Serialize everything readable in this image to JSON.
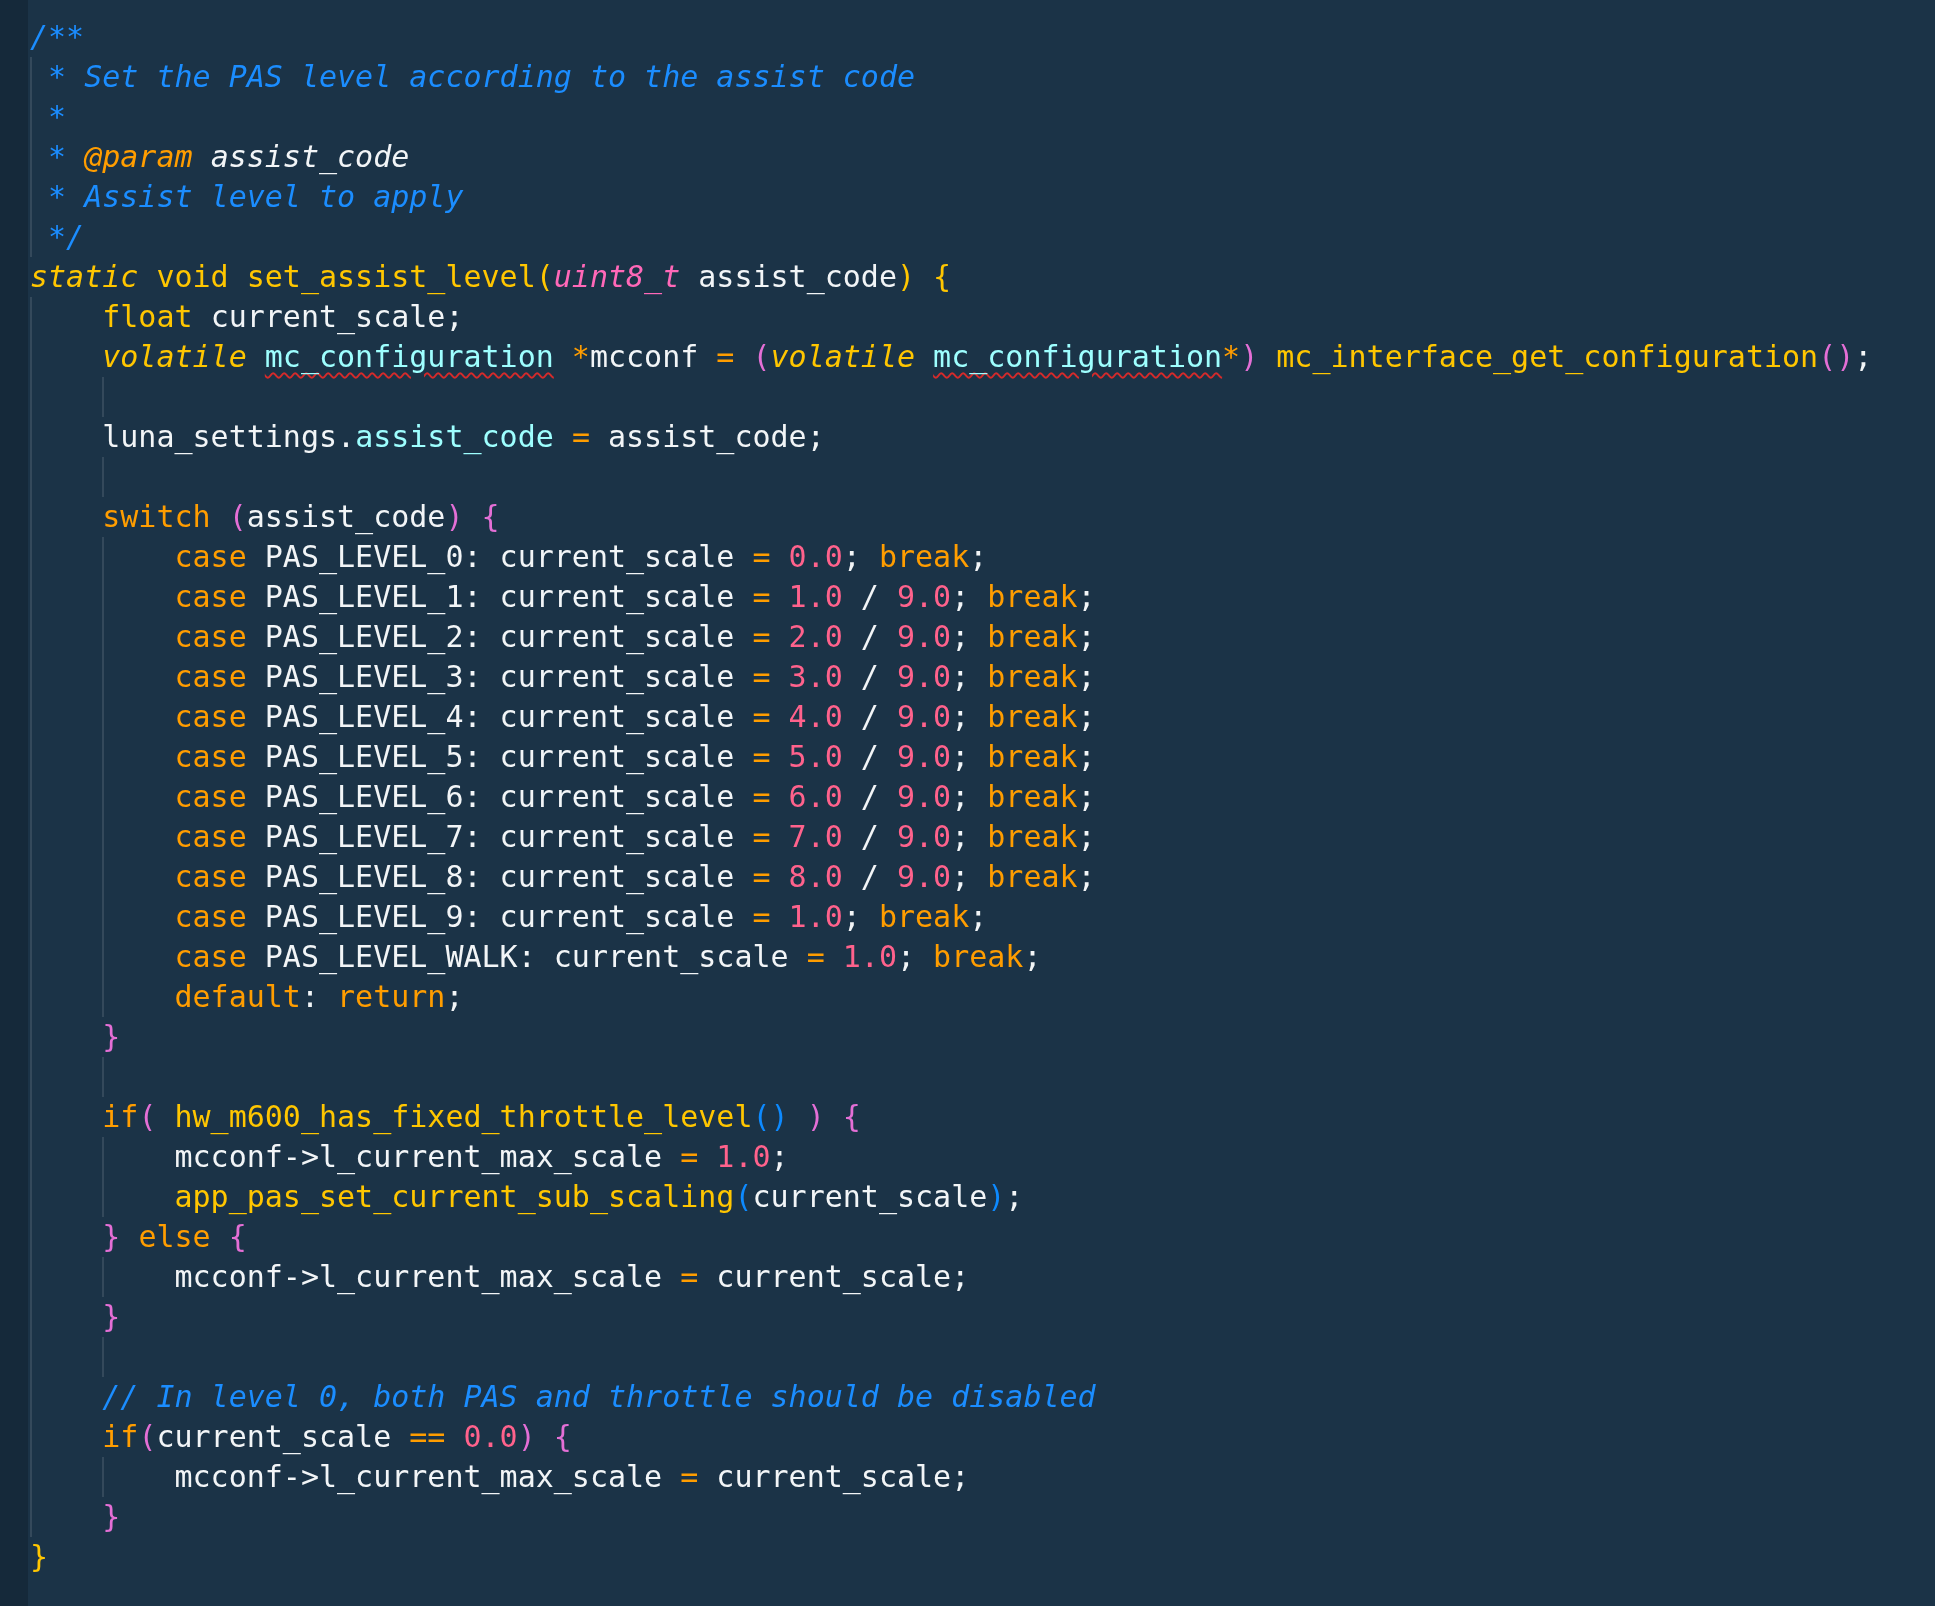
{
  "editor": {
    "lines": [
      {
        "kind": "code",
        "tokens": [
          {
            "text": "/**",
            "kind": "comment"
          }
        ]
      },
      {
        "kind": "code",
        "tokens": [
          {
            "text": " * Set the PAS level according to the assist code",
            "kind": "comment"
          }
        ]
      },
      {
        "kind": "code",
        "tokens": [
          {
            "text": " *",
            "kind": "comment"
          }
        ]
      },
      {
        "kind": "code",
        "tokens": [
          {
            "text": " *",
            "kind": "comment"
          },
          {
            "text": " @param",
            "kind": "doctag"
          },
          {
            "text": " assist_code",
            "kind": "docparam"
          }
        ]
      },
      {
        "kind": "code",
        "tokens": [
          {
            "text": " * Assist level to apply",
            "kind": "comment"
          }
        ]
      },
      {
        "kind": "code",
        "tokens": [
          {
            "text": " */",
            "kind": "comment"
          }
        ]
      },
      {
        "kind": "code",
        "tokens": [
          {
            "text": "static",
            "kind": "storage"
          },
          {
            "text": " void",
            "kind": "keyword"
          },
          {
            "text": " set_assist_level",
            "kind": "function"
          },
          {
            "text": "(",
            "kind": "fnbrace"
          },
          {
            "text": "uint8_t",
            "kind": "type"
          },
          {
            "text": " assist_code",
            "kind": "identifier"
          },
          {
            "text": ")",
            "kind": "fnbrace"
          },
          {
            "text": " {",
            "kind": "fnbrace"
          }
        ]
      },
      {
        "kind": "code",
        "tokens": [
          {
            "text": "    float",
            "kind": "keyword"
          },
          {
            "text": " current_scale;",
            "kind": "identifier"
          }
        ]
      },
      {
        "kind": "code",
        "tokens": [
          {
            "text": "    volatile",
            "kind": "storage"
          },
          {
            "text": " mc_configuration",
            "kind": "typeref",
            "error": true
          },
          {
            "text": " *",
            "kind": "operator"
          },
          {
            "text": "mcconf",
            "kind": "identifier"
          },
          {
            "text": " =",
            "kind": "operator"
          },
          {
            "text": " (",
            "kind": "bracket"
          },
          {
            "text": "volatile",
            "kind": "storage"
          },
          {
            "text": " mc_configuration",
            "kind": "typeref",
            "error": true
          },
          {
            "text": "*",
            "kind": "operator"
          },
          {
            "text": ")",
            "kind": "bracket"
          },
          {
            "text": " mc_interface_get_configuration",
            "kind": "function"
          },
          {
            "text": "()",
            "kind": "bracket"
          },
          {
            "text": ";",
            "kind": "identifier"
          }
        ]
      },
      {
        "kind": "blank"
      },
      {
        "kind": "code",
        "tokens": [
          {
            "text": "    luna_settings.",
            "kind": "identifier"
          },
          {
            "text": "assist_code",
            "kind": "member"
          },
          {
            "text": " =",
            "kind": "operator"
          },
          {
            "text": " assist_code;",
            "kind": "identifier"
          }
        ]
      },
      {
        "kind": "blank"
      },
      {
        "kind": "code",
        "tokens": [
          {
            "text": "    switch",
            "kind": "control"
          },
          {
            "text": " (",
            "kind": "bracket"
          },
          {
            "text": "assist_code",
            "kind": "identifier"
          },
          {
            "text": ")",
            "kind": "bracket"
          },
          {
            "text": " {",
            "kind": "bracket"
          }
        ]
      },
      {
        "kind": "code",
        "tokens": [
          {
            "text": "        case",
            "kind": "control"
          },
          {
            "text": " PAS_LEVEL_0: current_scale",
            "kind": "identifier"
          },
          {
            "text": " =",
            "kind": "operator"
          },
          {
            "text": " 0.0",
            "kind": "number"
          },
          {
            "text": ";",
            "kind": "identifier"
          },
          {
            "text": " break",
            "kind": "control"
          },
          {
            "text": ";",
            "kind": "identifier"
          }
        ]
      },
      {
        "kind": "code",
        "tokens": [
          {
            "text": "        case",
            "kind": "control"
          },
          {
            "text": " PAS_LEVEL_1: current_scale",
            "kind": "identifier"
          },
          {
            "text": " =",
            "kind": "operator"
          },
          {
            "text": " 1.0",
            "kind": "number"
          },
          {
            "text": " /",
            "kind": "identifier"
          },
          {
            "text": " 9.0",
            "kind": "number"
          },
          {
            "text": ";",
            "kind": "identifier"
          },
          {
            "text": " break",
            "kind": "control"
          },
          {
            "text": ";",
            "kind": "identifier"
          }
        ]
      },
      {
        "kind": "code",
        "tokens": [
          {
            "text": "        case",
            "kind": "control"
          },
          {
            "text": " PAS_LEVEL_2: current_scale",
            "kind": "identifier"
          },
          {
            "text": " =",
            "kind": "operator"
          },
          {
            "text": " 2.0",
            "kind": "number"
          },
          {
            "text": " /",
            "kind": "identifier"
          },
          {
            "text": " 9.0",
            "kind": "number"
          },
          {
            "text": ";",
            "kind": "identifier"
          },
          {
            "text": " break",
            "kind": "control"
          },
          {
            "text": ";",
            "kind": "identifier"
          }
        ]
      },
      {
        "kind": "code",
        "tokens": [
          {
            "text": "        case",
            "kind": "control"
          },
          {
            "text": " PAS_LEVEL_3: current_scale",
            "kind": "identifier"
          },
          {
            "text": " =",
            "kind": "operator"
          },
          {
            "text": " 3.0",
            "kind": "number"
          },
          {
            "text": " /",
            "kind": "identifier"
          },
          {
            "text": " 9.0",
            "kind": "number"
          },
          {
            "text": ";",
            "kind": "identifier"
          },
          {
            "text": " break",
            "kind": "control"
          },
          {
            "text": ";",
            "kind": "identifier"
          }
        ]
      },
      {
        "kind": "code",
        "tokens": [
          {
            "text": "        case",
            "kind": "control"
          },
          {
            "text": " PAS_LEVEL_4: current_scale",
            "kind": "identifier"
          },
          {
            "text": " =",
            "kind": "operator"
          },
          {
            "text": " 4.0",
            "kind": "number"
          },
          {
            "text": " /",
            "kind": "identifier"
          },
          {
            "text": " 9.0",
            "kind": "number"
          },
          {
            "text": ";",
            "kind": "identifier"
          },
          {
            "text": " break",
            "kind": "control"
          },
          {
            "text": ";",
            "kind": "identifier"
          }
        ]
      },
      {
        "kind": "code",
        "tokens": [
          {
            "text": "        case",
            "kind": "control"
          },
          {
            "text": " PAS_LEVEL_5: current_scale",
            "kind": "identifier"
          },
          {
            "text": " =",
            "kind": "operator"
          },
          {
            "text": " 5.0",
            "kind": "number"
          },
          {
            "text": " /",
            "kind": "identifier"
          },
          {
            "text": " 9.0",
            "kind": "number"
          },
          {
            "text": ";",
            "kind": "identifier"
          },
          {
            "text": " break",
            "kind": "control"
          },
          {
            "text": ";",
            "kind": "identifier"
          }
        ]
      },
      {
        "kind": "code",
        "tokens": [
          {
            "text": "        case",
            "kind": "control"
          },
          {
            "text": " PAS_LEVEL_6: current_scale",
            "kind": "identifier"
          },
          {
            "text": " =",
            "kind": "operator"
          },
          {
            "text": " 6.0",
            "kind": "number"
          },
          {
            "text": " /",
            "kind": "identifier"
          },
          {
            "text": " 9.0",
            "kind": "number"
          },
          {
            "text": ";",
            "kind": "identifier"
          },
          {
            "text": " break",
            "kind": "control"
          },
          {
            "text": ";",
            "kind": "identifier"
          }
        ]
      },
      {
        "kind": "code",
        "tokens": [
          {
            "text": "        case",
            "kind": "control"
          },
          {
            "text": " PAS_LEVEL_7: current_scale",
            "kind": "identifier"
          },
          {
            "text": " =",
            "kind": "operator"
          },
          {
            "text": " 7.0",
            "kind": "number"
          },
          {
            "text": " /",
            "kind": "identifier"
          },
          {
            "text": " 9.0",
            "kind": "number"
          },
          {
            "text": ";",
            "kind": "identifier"
          },
          {
            "text": " break",
            "kind": "control"
          },
          {
            "text": ";",
            "kind": "identifier"
          }
        ]
      },
      {
        "kind": "code",
        "tokens": [
          {
            "text": "        case",
            "kind": "control"
          },
          {
            "text": " PAS_LEVEL_8: current_scale",
            "kind": "identifier"
          },
          {
            "text": " =",
            "kind": "operator"
          },
          {
            "text": " 8.0",
            "kind": "number"
          },
          {
            "text": " /",
            "kind": "identifier"
          },
          {
            "text": " 9.0",
            "kind": "number"
          },
          {
            "text": ";",
            "kind": "identifier"
          },
          {
            "text": " break",
            "kind": "control"
          },
          {
            "text": ";",
            "kind": "identifier"
          }
        ]
      },
      {
        "kind": "code",
        "tokens": [
          {
            "text": "        case",
            "kind": "control"
          },
          {
            "text": " PAS_LEVEL_9: current_scale",
            "kind": "identifier"
          },
          {
            "text": " =",
            "kind": "operator"
          },
          {
            "text": " 1.0",
            "kind": "number"
          },
          {
            "text": ";",
            "kind": "identifier"
          },
          {
            "text": " break",
            "kind": "control"
          },
          {
            "text": ";",
            "kind": "identifier"
          }
        ]
      },
      {
        "kind": "code",
        "tokens": [
          {
            "text": "        case",
            "kind": "control"
          },
          {
            "text": " PAS_LEVEL_WALK: current_scale",
            "kind": "identifier"
          },
          {
            "text": " =",
            "kind": "operator"
          },
          {
            "text": " 1.0",
            "kind": "number"
          },
          {
            "text": ";",
            "kind": "identifier"
          },
          {
            "text": " break",
            "kind": "control"
          },
          {
            "text": ";",
            "kind": "identifier"
          }
        ]
      },
      {
        "kind": "code",
        "tokens": [
          {
            "text": "        default",
            "kind": "control"
          },
          {
            "text": ":",
            "kind": "identifier"
          },
          {
            "text": " return",
            "kind": "control"
          },
          {
            "text": ";",
            "kind": "identifier"
          }
        ]
      },
      {
        "kind": "code",
        "tokens": [
          {
            "text": "    }",
            "kind": "bracket"
          }
        ]
      },
      {
        "kind": "blank"
      },
      {
        "kind": "code",
        "tokens": [
          {
            "text": "    if",
            "kind": "control"
          },
          {
            "text": "(",
            "kind": "bracket"
          },
          {
            "text": " hw_m600_has_fixed_throttle_level",
            "kind": "function"
          },
          {
            "text": "()",
            "kind": "callparen"
          },
          {
            "text": " )",
            "kind": "bracket"
          },
          {
            "text": " {",
            "kind": "bracket"
          }
        ]
      },
      {
        "kind": "code",
        "tokens": [
          {
            "text": "        mcconf->l_current_max_scale",
            "kind": "identifier"
          },
          {
            "text": " =",
            "kind": "operator"
          },
          {
            "text": " 1.0",
            "kind": "number"
          },
          {
            "text": ";",
            "kind": "identifier"
          }
        ]
      },
      {
        "kind": "code",
        "tokens": [
          {
            "text": "        app_pas_set_current_sub_scaling",
            "kind": "function"
          },
          {
            "text": "(",
            "kind": "callparen"
          },
          {
            "text": "current_scale",
            "kind": "identifier"
          },
          {
            "text": ")",
            "kind": "callparen"
          },
          {
            "text": ";",
            "kind": "identifier"
          }
        ]
      },
      {
        "kind": "code",
        "tokens": [
          {
            "text": "    }",
            "kind": "bracket"
          },
          {
            "text": " else",
            "kind": "control"
          },
          {
            "text": " {",
            "kind": "bracket"
          }
        ]
      },
      {
        "kind": "code",
        "tokens": [
          {
            "text": "        mcconf->l_current_max_scale",
            "kind": "identifier"
          },
          {
            "text": " =",
            "kind": "operator"
          },
          {
            "text": " current_scale;",
            "kind": "identifier"
          }
        ]
      },
      {
        "kind": "code",
        "tokens": [
          {
            "text": "    }",
            "kind": "bracket"
          }
        ]
      },
      {
        "kind": "blank"
      },
      {
        "kind": "code",
        "tokens": [
          {
            "text": "    // In level 0, both PAS and throttle should be disabled",
            "kind": "comment"
          }
        ]
      },
      {
        "kind": "code",
        "tokens": [
          {
            "text": "    if",
            "kind": "control"
          },
          {
            "text": "(",
            "kind": "bracket"
          },
          {
            "text": "current_scale",
            "kind": "identifier"
          },
          {
            "text": " ==",
            "kind": "operator"
          },
          {
            "text": " 0.0",
            "kind": "number"
          },
          {
            "text": ")",
            "kind": "bracket"
          },
          {
            "text": " {",
            "kind": "bracket"
          }
        ]
      },
      {
        "kind": "code",
        "tokens": [
          {
            "text": "        mcconf->l_current_max_scale",
            "kind": "identifier"
          },
          {
            "text": " =",
            "kind": "operator"
          },
          {
            "text": " current_scale;",
            "kind": "identifier"
          }
        ]
      },
      {
        "kind": "code",
        "tokens": [
          {
            "text": "    }",
            "kind": "bracket"
          }
        ]
      },
      {
        "kind": "code",
        "tokens": [
          {
            "text": "}",
            "kind": "fnbrace"
          }
        ]
      }
    ]
  }
}
